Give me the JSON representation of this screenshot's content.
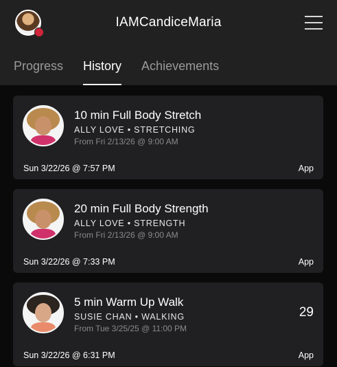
{
  "header": {
    "username": "IAMCandiceMaria",
    "avatar_icon": "user-avatar",
    "menu_icon": "hamburger-menu-icon"
  },
  "tabs": [
    {
      "label": "Progress",
      "active": false
    },
    {
      "label": "History",
      "active": true
    },
    {
      "label": "Achievements",
      "active": false
    }
  ],
  "workouts": [
    {
      "title": "10 min Full Body Stretch",
      "instructor_line": "ALLY LOVE • STRETCHING",
      "from": "From Fri 2/13/26 @ 9:00 AM",
      "date": "Sun 3/22/26 @ 7:57 PM",
      "source": "App",
      "score": ""
    },
    {
      "title": "20 min Full Body Strength",
      "instructor_line": "ALLY LOVE • STRENGTH",
      "from": "From Fri 2/13/26 @ 9:00 AM",
      "date": "Sun 3/22/26 @ 7:33 PM",
      "source": "App",
      "score": ""
    },
    {
      "title": "5 min Warm Up Walk",
      "instructor_line": "SUSIE CHAN • WALKING",
      "from": "From Tue 3/25/25 @ 11:00 PM",
      "date": "Sun 3/22/26 @ 6:31 PM",
      "source": "App",
      "score": "29"
    }
  ]
}
